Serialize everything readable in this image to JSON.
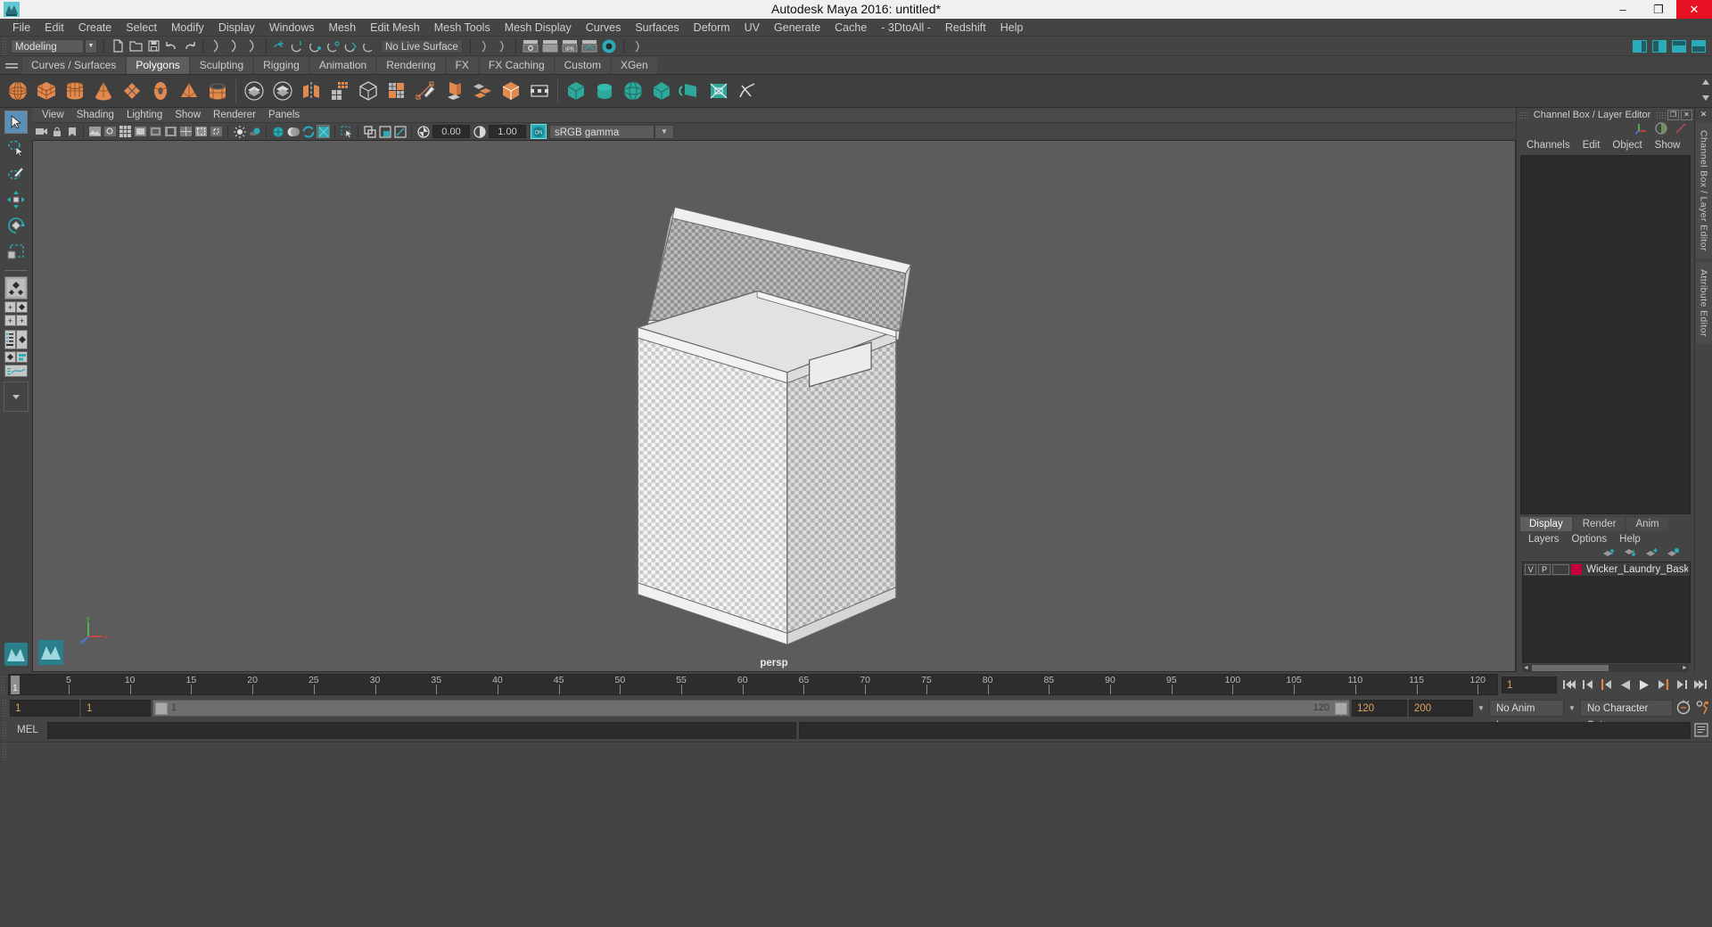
{
  "window": {
    "title": "Autodesk Maya 2016: untitled*",
    "app_icon": "maya-logo-icon",
    "buttons": {
      "minimize": "–",
      "maximize": "❐",
      "close": "✕"
    }
  },
  "menubar": {
    "items": [
      "File",
      "Edit",
      "Create",
      "Select",
      "Modify",
      "Display",
      "Windows",
      "Mesh",
      "Edit Mesh",
      "Mesh Tools",
      "Mesh Display",
      "Curves",
      "Surfaces",
      "Deform",
      "UV",
      "Generate",
      "Cache",
      "- 3DtoAll -",
      "Redshift",
      "Help"
    ]
  },
  "statusline": {
    "menuset": "Modeling",
    "live_surface": "No Live Surface",
    "icons": [
      "new-scene-icon",
      "open-scene-icon",
      "save-scene-icon",
      "undo-icon",
      "redo-icon",
      "select-by-hierarchy-icon",
      "select-by-object-icon",
      "select-by-component-icon",
      "snap-to-grid-icon",
      "snap-to-curve-icon",
      "snap-to-point-icon",
      "snap-to-projected-center-icon",
      "snap-to-view-plane-icon",
      "make-live-icon",
      "render-current-frame-icon",
      "ipr-render-icon",
      "render-settings-icon",
      "hypershade-icon",
      "render-view-icon"
    ],
    "right_icons": [
      "sidebar-toggle-icon",
      "attribute-editor-toggle-icon",
      "channel-box-toggle-icon",
      "tool-settings-toggle-icon"
    ]
  },
  "shelf": {
    "tabs": [
      {
        "label": "Curves / Surfaces",
        "active": false
      },
      {
        "label": "Polygons",
        "active": true
      },
      {
        "label": "Sculpting",
        "active": false
      },
      {
        "label": "Rigging",
        "active": false
      },
      {
        "label": "Animation",
        "active": false
      },
      {
        "label": "Rendering",
        "active": false
      },
      {
        "label": "FX",
        "active": false
      },
      {
        "label": "FX Caching",
        "active": false
      },
      {
        "label": "Custom",
        "active": false
      },
      {
        "label": "XGen",
        "active": false
      }
    ],
    "icons": [
      "poly-sphere-icon",
      "poly-cube-icon",
      "poly-cylinder-icon",
      "poly-cone-icon",
      "poly-plane-icon",
      "poly-torus-icon",
      "poly-pyramid-icon",
      "poly-pipe-icon",
      "poly-combine-icon",
      "poly-separate-icon",
      "poly-mirror-icon",
      "poly-smooth-icon",
      "poly-extract-icon",
      "poly-booleans-icon",
      "poly-create-tool-icon",
      "poly-extrude-icon",
      "poly-bevel-icon",
      "poly-bridge-icon",
      "poly-append-icon",
      "poly-wedge-icon",
      "poly-duplicate-face-icon",
      "uv-planar-icon",
      "uv-cylindrical-icon",
      "uv-spherical-icon",
      "uv-automatic-icon",
      "uv-editor-icon",
      "uv-cut-icon",
      "uv-sew-icon"
    ]
  },
  "toolbox": {
    "tools": [
      {
        "name": "select-tool",
        "selected": true
      },
      {
        "name": "lasso-select-tool",
        "selected": false
      },
      {
        "name": "paint-select-tool",
        "selected": false
      },
      {
        "name": "move-tool",
        "selected": false
      },
      {
        "name": "rotate-tool",
        "selected": false
      },
      {
        "name": "scale-tool",
        "selected": false
      }
    ],
    "layouts": [
      "single-perspective-layout",
      "four-view-layout",
      "persp-outliner-layout",
      "persp-graph-editor-layout",
      "hypershade-layout",
      "outliner-persp-layout",
      "persp-graph-layout",
      "layout-dropdown"
    ]
  },
  "viewport": {
    "menus": [
      "View",
      "Shading",
      "Lighting",
      "Show",
      "Renderer",
      "Panels"
    ],
    "toolbar": {
      "icons": [
        "select-camera-icon",
        "lock-camera-icon",
        "bookmark-icon",
        "image-plane-icon",
        "2d-pan-zoom-icon",
        "grid-toggle-icon",
        "film-gate-icon",
        "resolution-gate-icon",
        "gate-mask-icon",
        "field-chart-icon",
        "safe-action-icon",
        "safe-title-icon",
        "wireframe-icon",
        "smooth-shade-all-icon",
        "shade-selected-icon",
        "wireframe-on-shaded-icon",
        "texture-toggle-icon",
        "lighting-toggle-icon",
        "shadows-icon",
        "ao-icon",
        "motion-blur-icon",
        "multisample-icon",
        "isolate-select-icon",
        "xray-icon",
        "xray-joints-icon",
        "xray-active-components-icon",
        "exposure-icon",
        "gamma-icon"
      ],
      "exposure_value": "0.00",
      "gamma_value": "1.00",
      "color_management_toggle": "ON",
      "view_transform": "sRGB gamma"
    },
    "camera_label": "persp",
    "axis_labels": {
      "x": "x",
      "y": "y",
      "z": "z"
    }
  },
  "channel_box": {
    "panel_title": "Channel Box / Layer Editor",
    "window_buttons": [
      "undock-icon",
      "close-icon"
    ],
    "top_icons": [
      "show-manipulators-icon",
      "toggle-channel-box-icon",
      "toggle-attribute-editor-icon"
    ],
    "menus": [
      "Channels",
      "Edit",
      "Object",
      "Show"
    ]
  },
  "layer_editor": {
    "tabs": [
      {
        "label": "Display",
        "active": true
      },
      {
        "label": "Render",
        "active": false
      },
      {
        "label": "Anim",
        "active": false
      }
    ],
    "menus": [
      "Layers",
      "Options",
      "Help"
    ],
    "buttons": [
      "move-layer-up-icon",
      "move-layer-down-icon",
      "create-new-layer-icon",
      "create-layer-from-selected-icon"
    ],
    "layers": [
      {
        "visibility": "V",
        "playback": "P",
        "state": "",
        "color": "#c3003c",
        "name": "Wicker_Laundry_Basket_"
      }
    ]
  },
  "right_bars": [
    {
      "label": "Channel Box / Layer Editor"
    },
    {
      "label": "Attribute Editor"
    }
  ],
  "timeline": {
    "ticks": [
      5,
      10,
      15,
      20,
      25,
      30,
      35,
      40,
      45,
      50,
      55,
      60,
      65,
      70,
      75,
      80,
      85,
      90,
      95,
      100,
      105,
      110,
      115,
      120
    ],
    "start": 1,
    "end": 120,
    "current_frame_marker": "1",
    "current_frame_field": "1",
    "playback_buttons": [
      "go-to-start-icon",
      "step-back-frame-icon",
      "step-back-key-icon",
      "play-backwards-icon",
      "play-forwards-icon",
      "step-forward-key-icon",
      "step-forward-frame-icon",
      "go-to-end-icon"
    ]
  },
  "range_slider": {
    "anim_start": "1",
    "anim_end": "1",
    "range_start_label": "1",
    "range_end_label": "120",
    "playback_end": "120",
    "anim_end_total": "200",
    "anim_layer": "No Anim Layer",
    "character_set": "No Character Set",
    "icons": [
      "auto-keyframe-icon",
      "animation-preferences-icon"
    ]
  },
  "command_line": {
    "label": "MEL",
    "input_value": "",
    "output_value": "",
    "script_editor_icon": "script-editor-icon"
  },
  "colors": {
    "bg": "#444444",
    "panel": "#3f3f3f",
    "viewport": "#5c5c5c",
    "accent_orange": "#e08040",
    "accent_teal": "#2aabb8",
    "field_bg": "#2b2b2b",
    "layer_swatch": "#c3003c"
  }
}
